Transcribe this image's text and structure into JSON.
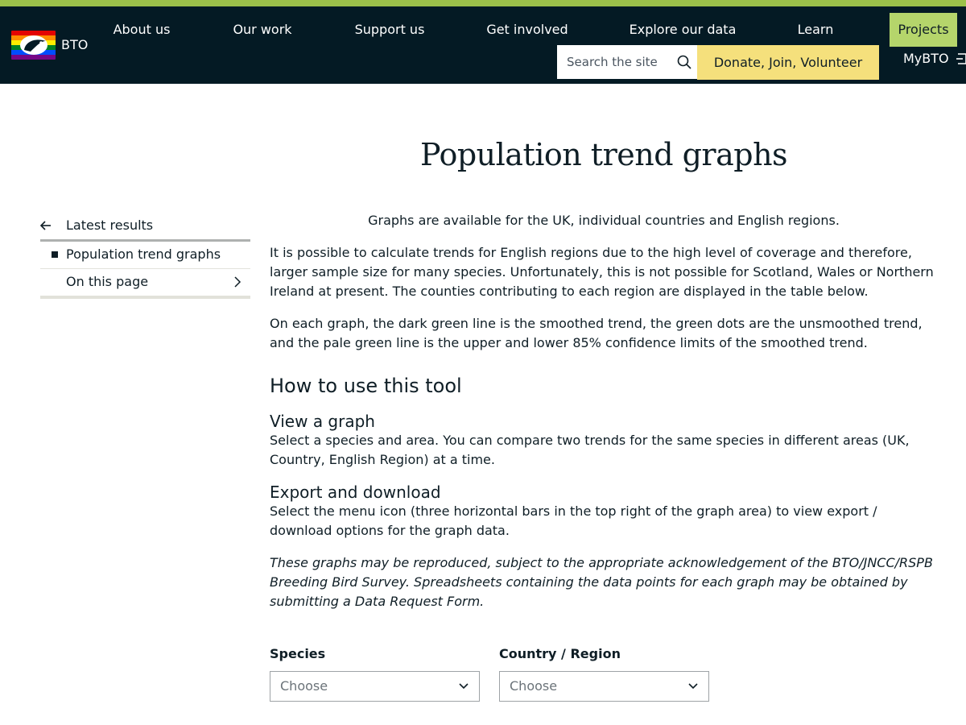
{
  "header": {
    "logo_text": "BTO",
    "nav": [
      {
        "label": "About us"
      },
      {
        "label": "Our work"
      },
      {
        "label": "Support us"
      },
      {
        "label": "Get involved"
      },
      {
        "label": "Explore our data"
      },
      {
        "label": "Learn"
      },
      {
        "label": "Projects",
        "active": true
      }
    ],
    "search": {
      "placeholder": "Search the site",
      "value": ""
    },
    "donate_label": "Donate, Join, Volunteer",
    "account_label": "MyBTO",
    "colors": {
      "accent_bar": "#9cc04a",
      "background": "#041a24",
      "active_tab": "#b5d56b",
      "donate": "#f5e07c"
    }
  },
  "page": {
    "title": "Population trend graphs"
  },
  "sidebar": {
    "back_label": "Latest results",
    "current_label": "Population trend graphs",
    "on_this_page_label": "On this page"
  },
  "content": {
    "intro": "Graphs are available for the UK, individual countries and English regions.",
    "para1": "It is possible to calculate trends for English regions due to the high level of coverage and therefore, larger sample size for many species. Unfortunately, this is not possible for Scotland, Wales or Northern Ireland at present. The counties contributing to each region are displayed in the table below.",
    "para2": "On each graph, the dark green line is the smoothed trend, the green dots are the unsmoothed trend, and the pale green line is the upper and lower 85% confidence limits of the smoothed trend.",
    "how_heading": "How to use this tool",
    "view_heading": "View a graph",
    "view_text": "Select a species and area. You can compare two trends for the same species in different areas (UK, Country, English Region) at a time.",
    "export_heading": "Export and download",
    "export_text": "Select the menu icon (three horizontal bars in the top right of the graph area) to view export / download options for the graph data.",
    "note": "These graphs may be reproduced, subject to the appropriate acknowledgement of the BTO/JNCC/RSPB Breeding Bird Survey.  Spreadsheets containing the data points for each graph may be obtained by submitting a Data Request Form."
  },
  "form": {
    "species": {
      "label": "Species",
      "value": "Choose"
    },
    "region": {
      "label": "Country / Region",
      "value": "Choose"
    }
  }
}
